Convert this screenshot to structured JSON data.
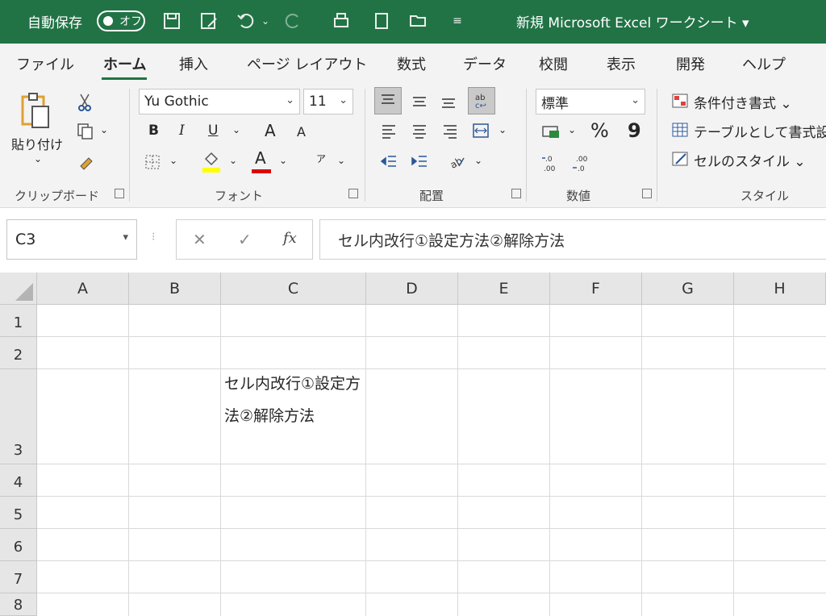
{
  "title_bar": {
    "autosave_label": "自動保存",
    "autosave_toggle": "オフ",
    "document_title": "新規 Microsoft Excel ワークシート ▾",
    "qat_icons": [
      "save-icon",
      "save-as-icon",
      "undo-icon",
      "redo-icon",
      "print-preview-icon",
      "export-icon",
      "open-folder-icon",
      "customize-icon"
    ]
  },
  "tabs": [
    "ファイル",
    "ホーム",
    "挿入",
    "ページ レイアウト",
    "数式",
    "データ",
    "校閲",
    "表示",
    "開発",
    "ヘルプ"
  ],
  "active_tab": "ホーム",
  "ribbon": {
    "clipboard": {
      "paste_label": "貼り付け",
      "group_label": "クリップボード"
    },
    "font": {
      "font_name": "Yu Gothic",
      "font_size": "11",
      "bold": "B",
      "italic": "I",
      "underline": "U",
      "grow": "A",
      "shrink": "A",
      "font_color_glyph": "A",
      "phonetic": "ア",
      "group_label": "フォント"
    },
    "alignment": {
      "group_label": "配置"
    },
    "number": {
      "format": "標準",
      "percent": "%",
      "comma": "9",
      "group_label": "数値"
    },
    "styles": {
      "conditional": "条件付き書式 ⌄",
      "table": "テーブルとして書式設定",
      "cell_styles": "セルのスタイル ⌄",
      "group_label": "スタイル"
    }
  },
  "formula_bar": {
    "name_box": "C3",
    "cancel": "✕",
    "enter": "✓",
    "fx": "fx",
    "content": "セル内改行①設定方法②解除方法"
  },
  "sheet": {
    "columns": [
      "A",
      "B",
      "C",
      "D",
      "E",
      "F",
      "G",
      "H"
    ],
    "rows": [
      "1",
      "2",
      "3",
      "4",
      "5",
      "6",
      "7",
      "8"
    ],
    "cell_C3": "セル内改行①設定方法②解除方法"
  }
}
